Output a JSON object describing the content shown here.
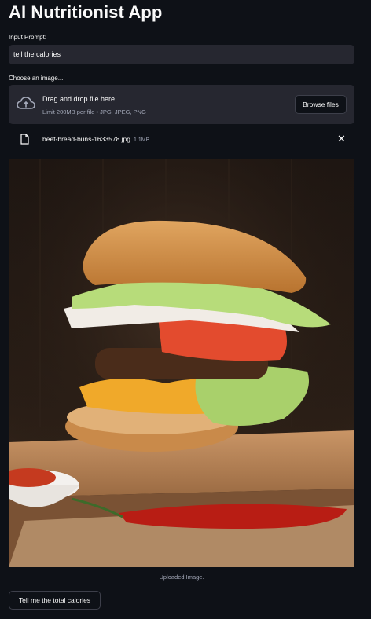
{
  "app": {
    "title": "AI Nutritionist App"
  },
  "prompt": {
    "label": "Input Prompt:",
    "value": "tell the calories"
  },
  "uploader": {
    "label": "Choose an image...",
    "drag_text": "Drag and drop file here",
    "limit_text": "Limit 200MB per file • JPG, JPEG, PNG",
    "browse_label": "Browse files",
    "icon": "upload-cloud-icon"
  },
  "file": {
    "name": "beef-bread-buns-1633578.jpg",
    "size": "1.1MB",
    "icon": "file-icon",
    "remove_icon": "close-icon"
  },
  "image": {
    "caption": "Uploaded Image."
  },
  "submit": {
    "label": "Tell me the total calories"
  }
}
